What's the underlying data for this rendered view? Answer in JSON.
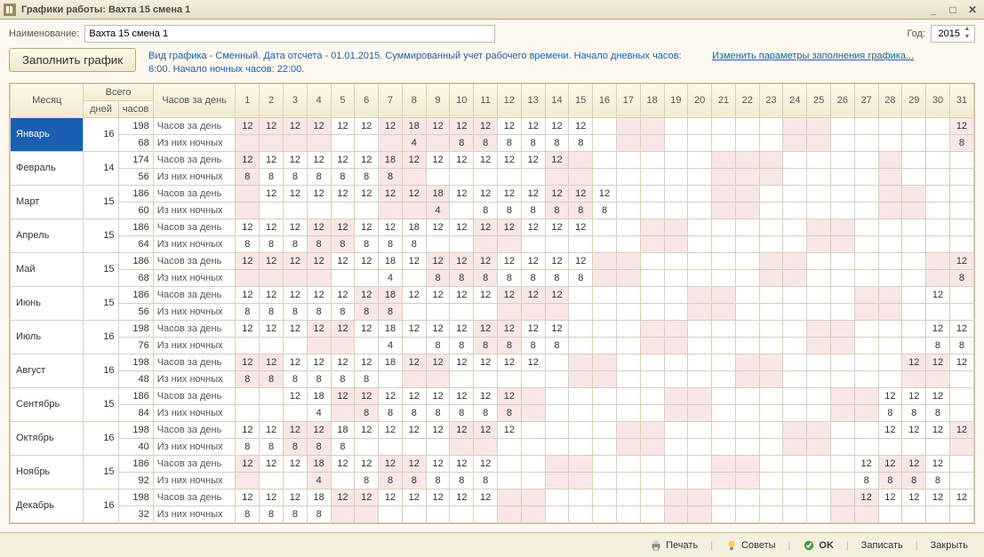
{
  "window": {
    "title": "Графики работы: Вахта 15 смена 1"
  },
  "form": {
    "name_label": "Наименование:",
    "name_value": "Вахта 15 смена 1",
    "year_label": "Год:",
    "year_value": "2015"
  },
  "actions": {
    "fill_button": "Заполнить график",
    "info_text": "Вид графика - Сменный. Дата отсчета - 01.01.2015. Суммированный учет рабочего времени. Начало дневных часов: 6:00. Начало ночных часов: 22:00.",
    "edit_link": "Изменить параметры заполнения графика..."
  },
  "headers": {
    "month": "Месяц",
    "total": "Всего",
    "days": "дней",
    "hours": "часов",
    "hours_per_day": "Часов за день",
    "row_hours": "Часов за день",
    "row_night": "Из них ночных"
  },
  "chart_data": {
    "type": "table",
    "day_columns": [
      1,
      2,
      3,
      4,
      5,
      6,
      7,
      8,
      9,
      10,
      11,
      12,
      13,
      14,
      15,
      16,
      17,
      18,
      19,
      20,
      21,
      22,
      23,
      24,
      25,
      26,
      27,
      28,
      29,
      30,
      31
    ],
    "weekend_days": {
      "Январь": [
        1,
        2,
        3,
        4,
        7,
        8,
        9,
        10,
        11,
        17,
        18,
        24,
        25,
        31
      ],
      "Февраль": [
        1,
        7,
        8,
        14,
        15,
        21,
        22,
        23,
        28
      ],
      "Март": [
        1,
        7,
        8,
        9,
        14,
        15,
        21,
        22,
        28,
        29
      ],
      "Апрель": [
        4,
        5,
        11,
        12,
        18,
        19,
        25,
        26
      ],
      "Май": [
        1,
        2,
        3,
        4,
        9,
        10,
        11,
        16,
        17,
        23,
        24,
        30,
        31
      ],
      "Июнь": [
        6,
        7,
        12,
        13,
        14,
        20,
        21,
        27,
        28
      ],
      "Июль": [
        4,
        5,
        11,
        12,
        18,
        19,
        25,
        26
      ],
      "Август": [
        1,
        2,
        8,
        9,
        15,
        16,
        22,
        23,
        29,
        30
      ],
      "Сентябрь": [
        5,
        6,
        12,
        13,
        19,
        20,
        26,
        27
      ],
      "Октябрь": [
        3,
        4,
        10,
        11,
        17,
        18,
        24,
        25,
        31
      ],
      "Ноябрь": [
        1,
        4,
        7,
        8,
        14,
        15,
        21,
        22,
        28,
        29
      ],
      "Декабрь": [
        5,
        6,
        12,
        13,
        19,
        20,
        26,
        27
      ]
    },
    "months": [
      {
        "name": "Январь",
        "days": 16,
        "hours": 198,
        "night": 68,
        "h": {
          "1": 12,
          "2": 12,
          "3": 12,
          "4": 12,
          "5": 12,
          "6": 12,
          "7": 12,
          "8": 18,
          "9": 12,
          "10": 12,
          "11": 12,
          "12": 12,
          "13": 12,
          "14": 12,
          "15": 12,
          "31": 12
        },
        "n": {
          "8": 4,
          "10": 8,
          "11": 8,
          "12": 8,
          "13": 8,
          "14": 8,
          "15": 8,
          "31": 8
        }
      },
      {
        "name": "Февраль",
        "days": 14,
        "hours": 174,
        "night": 56,
        "h": {
          "1": 12,
          "2": 12,
          "3": 12,
          "4": 12,
          "5": 12,
          "6": 12,
          "7": 18,
          "8": 12,
          "9": 12,
          "10": 12,
          "11": 12,
          "12": 12,
          "13": 12,
          "14": 12
        },
        "n": {
          "1": 8,
          "2": 8,
          "3": 8,
          "4": 8,
          "5": 8,
          "6": 8,
          "7": 8
        }
      },
      {
        "name": "Март",
        "days": 15,
        "hours": 186,
        "night": 60,
        "h": {
          "2": 12,
          "3": 12,
          "4": 12,
          "5": 12,
          "6": 12,
          "7": 12,
          "8": 12,
          "9": 18,
          "10": 12,
          "11": 12,
          "12": 12,
          "13": 12,
          "14": 12,
          "15": 12,
          "16": 12
        },
        "n": {
          "9": 4,
          "11": 8,
          "12": 8,
          "13": 8,
          "14": 8,
          "15": 8,
          "16": 8
        }
      },
      {
        "name": "Апрель",
        "days": 15,
        "hours": 186,
        "night": 64,
        "h": {
          "1": 12,
          "2": 12,
          "3": 12,
          "4": 12,
          "5": 12,
          "6": 12,
          "7": 12,
          "8": 18,
          "9": 12,
          "10": 12,
          "11": 12,
          "12": 12,
          "13": 12,
          "14": 12,
          "15": 12
        },
        "n": {
          "1": 8,
          "2": 8,
          "3": 8,
          "4": 8,
          "5": 8,
          "6": 8,
          "7": 8,
          "8": 8
        }
      },
      {
        "name": "Май",
        "days": 15,
        "hours": 186,
        "night": 68,
        "h": {
          "1": 12,
          "2": 12,
          "3": 12,
          "4": 12,
          "5": 12,
          "6": 12,
          "7": 18,
          "8": 12,
          "9": 12,
          "10": 12,
          "11": 12,
          "12": 12,
          "13": 12,
          "14": 12,
          "15": 12,
          "31": 12
        },
        "n": {
          "7": 4,
          "9": 8,
          "10": 8,
          "11": 8,
          "12": 8,
          "13": 8,
          "14": 8,
          "15": 8,
          "31": 8
        }
      },
      {
        "name": "Июнь",
        "days": 15,
        "hours": 186,
        "night": 56,
        "h": {
          "1": 12,
          "2": 12,
          "3": 12,
          "4": 12,
          "5": 12,
          "6": 12,
          "7": 18,
          "8": 12,
          "9": 12,
          "10": 12,
          "11": 12,
          "12": 12,
          "13": 12,
          "14": 12,
          "30": 12
        },
        "n": {
          "1": 8,
          "2": 8,
          "3": 8,
          "4": 8,
          "5": 8,
          "6": 8,
          "7": 8
        }
      },
      {
        "name": "Июль",
        "days": 16,
        "hours": 198,
        "night": 76,
        "h": {
          "1": 12,
          "2": 12,
          "3": 12,
          "4": 12,
          "5": 12,
          "6": 12,
          "7": 18,
          "8": 12,
          "9": 12,
          "10": 12,
          "11": 12,
          "12": 12,
          "13": 12,
          "14": 12,
          "30": 12,
          "31": 12
        },
        "n": {
          "7": 4,
          "9": 8,
          "10": 8,
          "11": 8,
          "12": 8,
          "13": 8,
          "14": 8,
          "30": 8,
          "31": 8
        }
      },
      {
        "name": "Август",
        "days": 16,
        "hours": 198,
        "night": 48,
        "h": {
          "1": 12,
          "2": 12,
          "3": 12,
          "4": 12,
          "5": 12,
          "6": 12,
          "7": 18,
          "8": 12,
          "9": 12,
          "10": 12,
          "11": 12,
          "12": 12,
          "13": 12,
          "29": 12,
          "30": 12,
          "31": 12
        },
        "n": {
          "1": 8,
          "2": 8,
          "3": 8,
          "4": 8,
          "5": 8,
          "6": 8
        }
      },
      {
        "name": "Сентябрь",
        "days": 15,
        "hours": 186,
        "night": 84,
        "h": {
          "3": 12,
          "4": 18,
          "5": 12,
          "6": 12,
          "7": 12,
          "8": 12,
          "9": 12,
          "10": 12,
          "11": 12,
          "12": 12,
          "28": 12,
          "29": 12,
          "30": 12
        },
        "n": {
          "4": 4,
          "6": 8,
          "7": 8,
          "8": 8,
          "9": 8,
          "10": 8,
          "11": 8,
          "12": 8,
          "28": 8,
          "29": 8,
          "30": 8
        }
      },
      {
        "name": "Октябрь",
        "days": 16,
        "hours": 198,
        "night": 40,
        "h": {
          "1": 12,
          "2": 12,
          "3": 12,
          "4": 12,
          "5": 18,
          "6": 12,
          "7": 12,
          "8": 12,
          "9": 12,
          "10": 12,
          "11": 12,
          "12": 12,
          "28": 12,
          "29": 12,
          "30": 12,
          "31": 12
        },
        "n": {
          "1": 8,
          "2": 8,
          "3": 8,
          "4": 8,
          "5": 8
        }
      },
      {
        "name": "Ноябрь",
        "days": 15,
        "hours": 186,
        "night": 92,
        "h": {
          "1": 12,
          "2": 12,
          "3": 12,
          "4": 18,
          "5": 12,
          "6": 12,
          "7": 12,
          "8": 12,
          "9": 12,
          "10": 12,
          "11": 12,
          "27": 12,
          "28": 12,
          "29": 12,
          "30": 12
        },
        "n": {
          "4": 4,
          "6": 8,
          "7": 8,
          "8": 8,
          "9": 8,
          "10": 8,
          "11": 8,
          "27": 8,
          "28": 8,
          "29": 8,
          "30": 8
        }
      },
      {
        "name": "Декабрь",
        "days": 16,
        "hours": 198,
        "night": 32,
        "h": {
          "1": 12,
          "2": 12,
          "3": 12,
          "4": 18,
          "5": 12,
          "6": 12,
          "7": 12,
          "8": 12,
          "9": 12,
          "10": 12,
          "11": 12,
          "27": 12,
          "28": 12,
          "29": 12,
          "30": 12,
          "31": 12
        },
        "n": {
          "1": 8,
          "2": 8,
          "3": 8,
          "4": 8
        }
      }
    ]
  },
  "footer": {
    "print": "Печать",
    "tips": "Советы",
    "ok": "OK",
    "save": "Записать",
    "close": "Закрыть"
  }
}
